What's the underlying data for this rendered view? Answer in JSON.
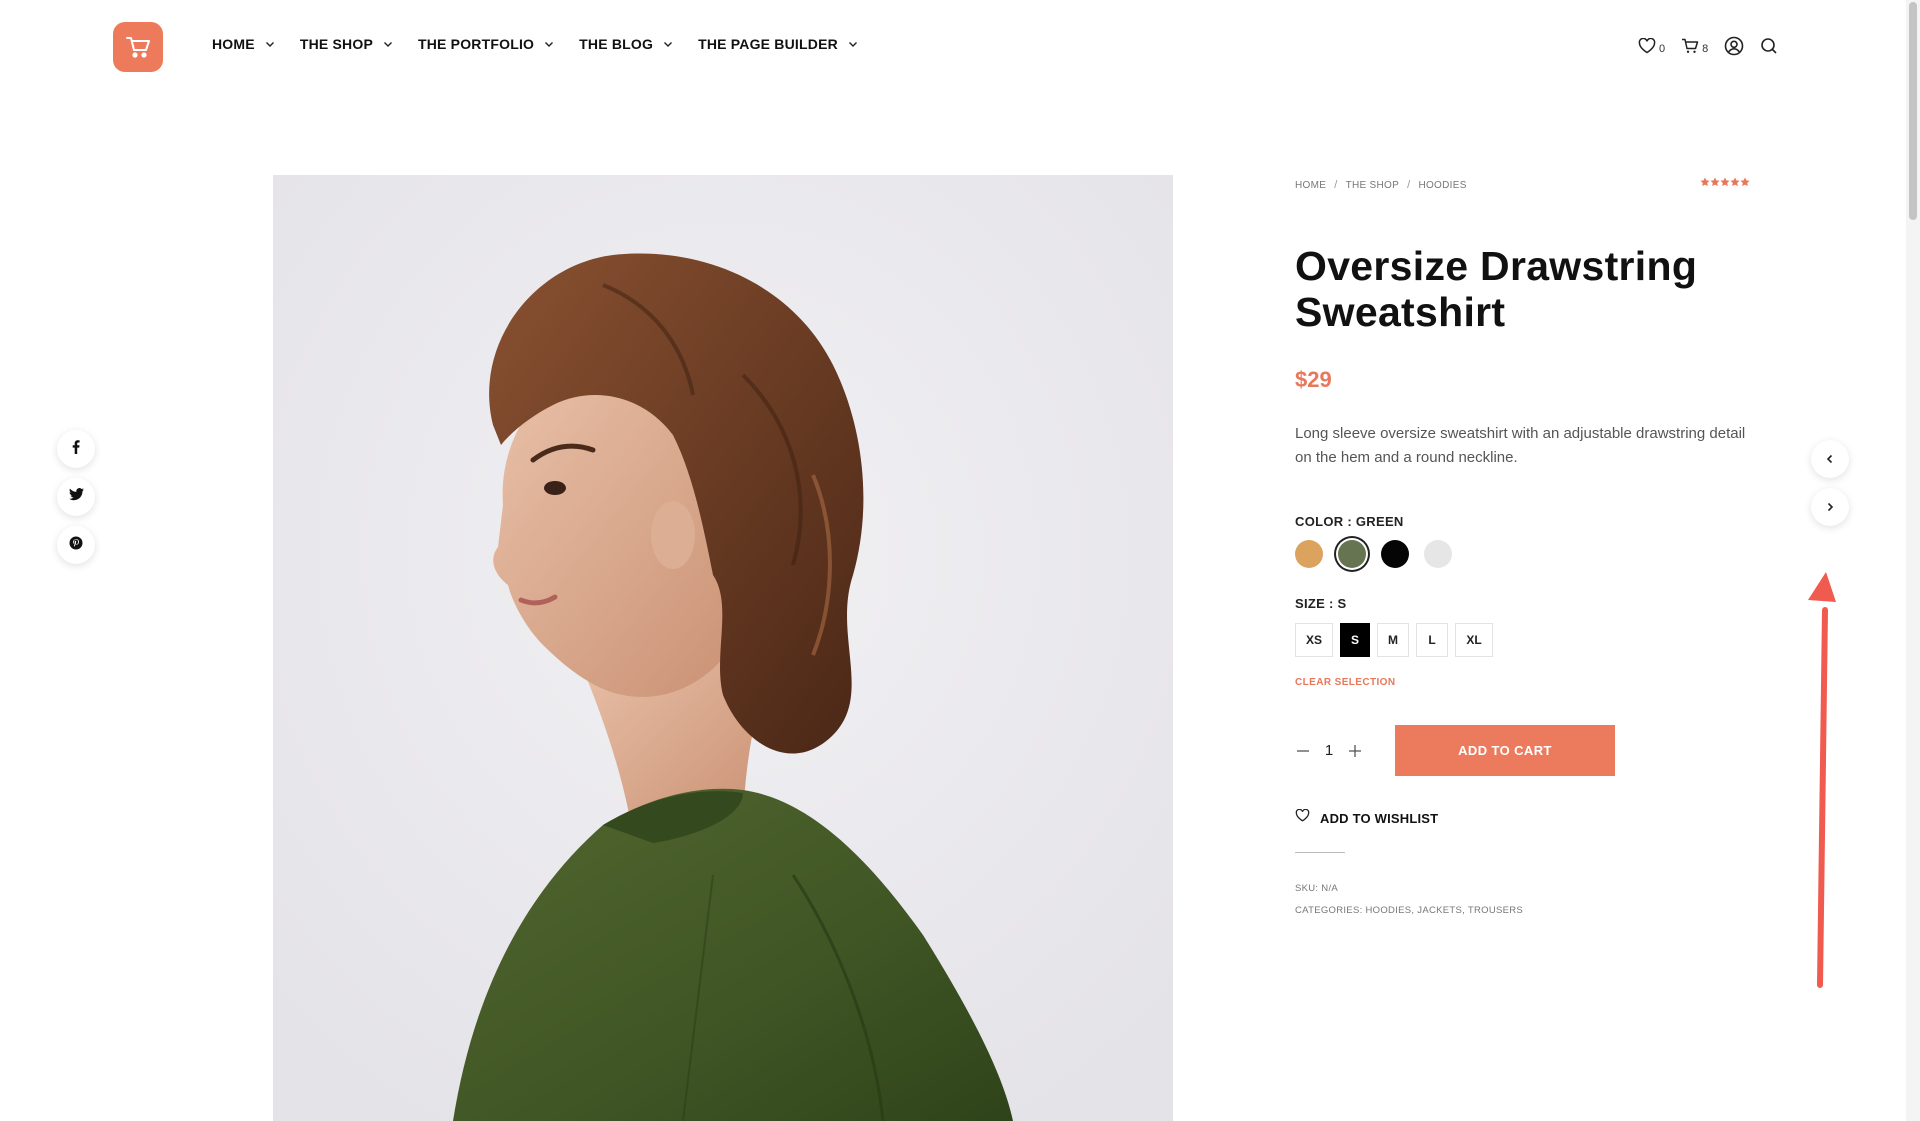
{
  "nav": {
    "items": [
      {
        "label": "HOME"
      },
      {
        "label": "THE SHOP"
      },
      {
        "label": "THE PORTFOLIO"
      },
      {
        "label": "THE BLOG"
      },
      {
        "label": "THE PAGE BUILDER"
      }
    ],
    "wishlist_count": "0",
    "cart_count": "8"
  },
  "breadcrumb": [
    "HOME",
    "THE SHOP",
    "HOODIES"
  ],
  "product": {
    "title": "Oversize Drawstring Sweatshirt",
    "price": "$29",
    "rating_stars": 5,
    "description": "Long sleeve oversize sweatshirt with an adjustable drawstring detail on the hem and a round neckline.",
    "color_label": "COLOR : GREEN",
    "colors": [
      {
        "name": "mustard",
        "hex": "#dba35e"
      },
      {
        "name": "green",
        "hex": "#667451",
        "selected": true
      },
      {
        "name": "black",
        "hex": "#050505"
      },
      {
        "name": "light-grey",
        "hex": "#e6e6e6"
      }
    ],
    "size_label": "SIZE : S",
    "sizes": [
      "XS",
      "S",
      "M",
      "L",
      "XL"
    ],
    "selected_size": "S",
    "clear_selection": "CLEAR SELECTION",
    "quantity": "1",
    "add_to_cart": "ADD TO CART",
    "add_to_wishlist": "ADD TO WISHLIST",
    "sku": "SKU: N/A",
    "categories_label": "CATEGORIES:",
    "categories": [
      "HOODIES",
      "JACKETS",
      "TROUSERS"
    ]
  },
  "colors": {
    "accent": "#ec7a5c",
    "annotation_arrow": "#f05a4f"
  }
}
